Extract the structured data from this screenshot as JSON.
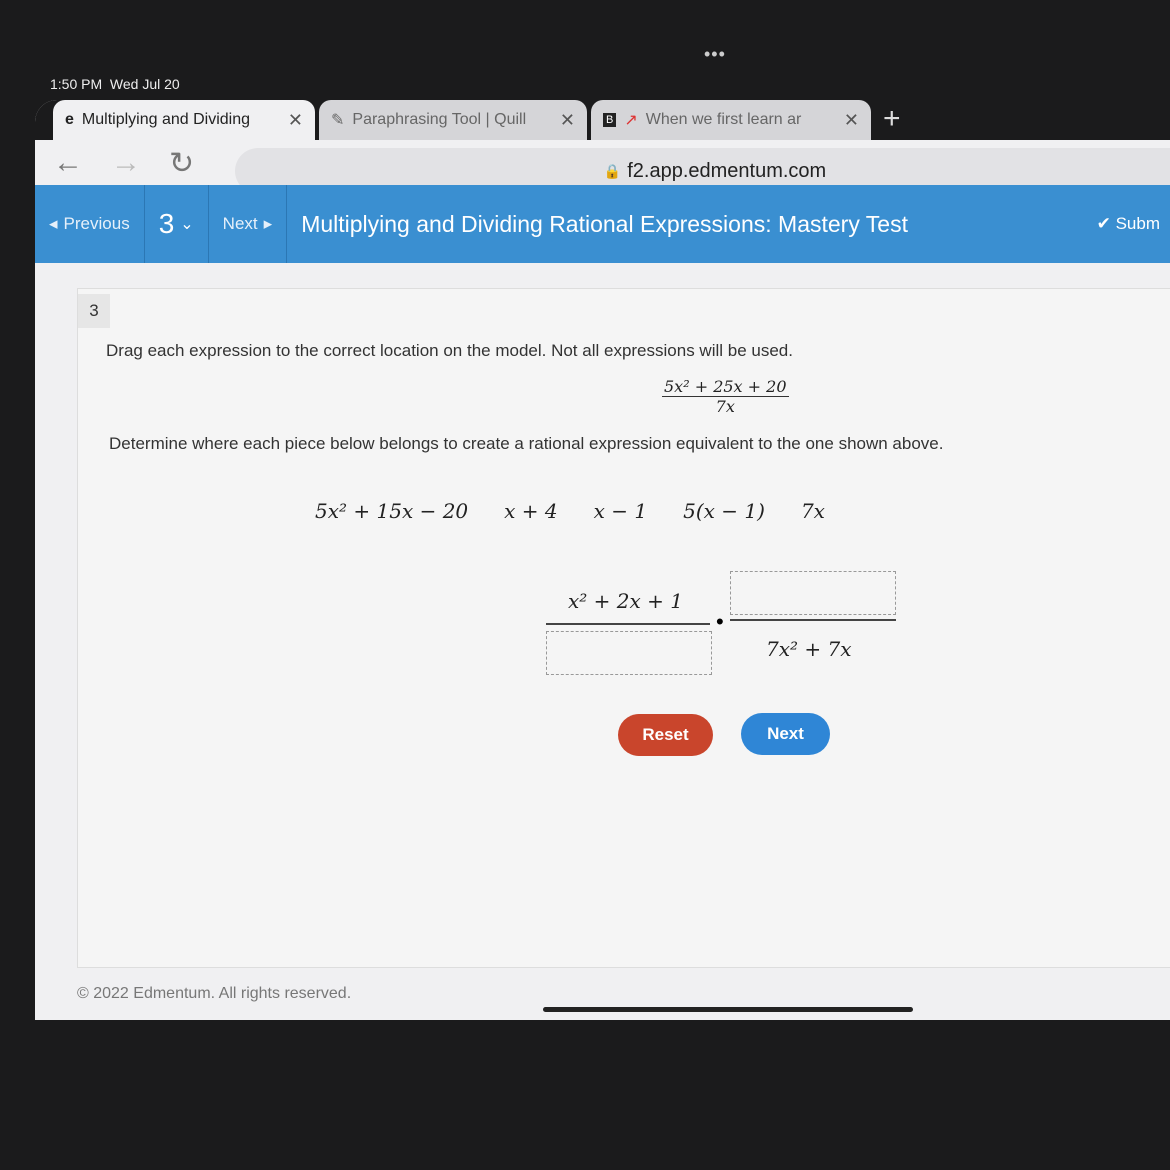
{
  "status_bar": {
    "time": "1:50 PM",
    "date": "Wed Jul 20"
  },
  "tabs": [
    {
      "label": "Multiplying and Dividing",
      "active": true
    },
    {
      "label": "Paraphrasing Tool | Quill",
      "active": false
    },
    {
      "label": "When we first learn ar",
      "active": false
    }
  ],
  "address_bar": {
    "url": "f2.app.edmentum.com"
  },
  "toolbar": {
    "previous": "Previous",
    "question_number": "3",
    "next": "Next",
    "title": "Multiplying and Dividing Rational Expressions: Mastery Test",
    "submit": "Subm"
  },
  "question": {
    "number": "3",
    "instruction": "Drag each expression to the correct location on the model. Not all expressions will be used.",
    "given": {
      "numerator": "5x² + 25x + 20",
      "denominator": "7x"
    },
    "prompt": "Determine where each piece below belongs to create a rational expression equivalent to the one shown above.",
    "pieces": [
      "5x² + 15x − 20",
      "x + 4",
      "x − 1",
      "5(x − 1)",
      "7x"
    ],
    "model": {
      "left_numerator": "x² + 2x + 1",
      "right_denominator": "7x² + 7x",
      "operator": "•"
    }
  },
  "buttons": {
    "reset": "Reset",
    "next": "Next"
  },
  "colors": {
    "toolbar": "#3a8fd1",
    "reset": "#c9452c",
    "next": "#2f86d6"
  },
  "footer": "© 2022 Edmentum. All rights reserved."
}
